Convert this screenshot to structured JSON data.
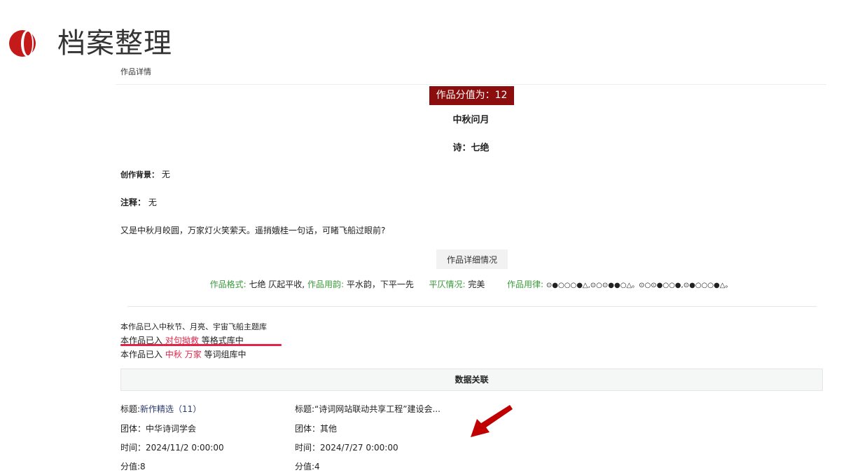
{
  "header": {
    "title": "档案整理",
    "breadcrumb": "作品详情"
  },
  "work": {
    "score_badge": "作品分值为：12",
    "title": "中秋问月",
    "type": "诗：七绝",
    "background_label": "创作背景：",
    "background_value": "无",
    "notes_label": "注释：",
    "notes_value": "无",
    "poem_text": "又是中秋月皎圆，万家灯火笑萦天。遥捎娥桂一句话，可睹飞船过眼前?",
    "detail_button": "作品详细情况",
    "format_label": "作品格式:",
    "format_value": "七绝 仄起平收,",
    "rhyme_label": "作品用韵:",
    "rhyme_value": "平水韵，下平一先",
    "tone_label": "平仄情况:",
    "tone_value": "完美",
    "meter_label": "作品用律:",
    "meter_value": "⊙●○○○●△,⊙○⊙●●○△。⊙○⊙●○○●,⊙●○○○●△。"
  },
  "libraries": {
    "line1": "本作品已入中秋节、月亮、宇宙飞船主题库",
    "line2_prefix": "本作品已入",
    "line2_link": "对句拗救",
    "line2_suffix": "等格式库中",
    "line3_prefix": "本作品已入",
    "line3_link1": "中秋",
    "line3_link2": "万家",
    "line3_suffix": "等词组库中"
  },
  "data_relation": {
    "heading": "数据关联",
    "items": [
      {
        "title_prefix": "标题:",
        "title": "新作精选（11）",
        "group": "团体：中华诗词学会",
        "time": "时间：2024/11/2 0:00:00",
        "score": "分值:8"
      },
      {
        "title_prefix": "标题:",
        "title": "“诗词网站联动共享工程”建设会...",
        "group": "团体：其他",
        "time": "时间：2024/7/27 0:00:00",
        "score": "分值:4"
      }
    ]
  },
  "colors": {
    "accent_red": "#8b0d0d",
    "link_red": "#e0244a",
    "label_green": "#3a9b3a",
    "arrow_red": "#c00000",
    "logo_red": "#c41a1a"
  }
}
